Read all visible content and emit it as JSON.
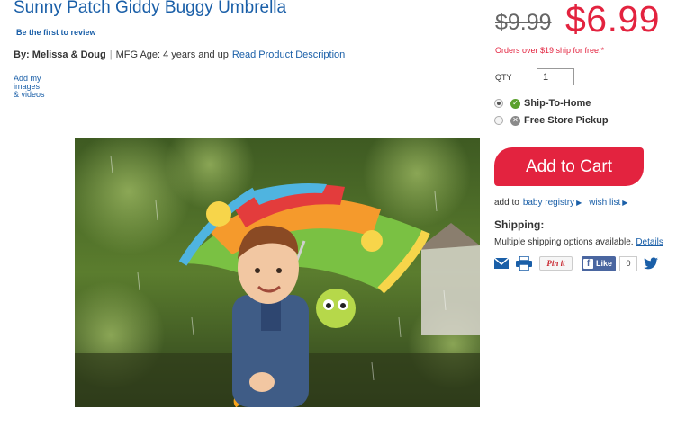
{
  "product": {
    "title": "Sunny Patch Giddy Buggy Umbrella",
    "review_link": "Be the first to review",
    "by_label": "By:",
    "brand": "Melissa & Doug",
    "mfg_age": "MFG Age: 4 years and up",
    "description_link": "Read Product Description",
    "add_media_lines": [
      "Add my",
      "images",
      "& videos"
    ]
  },
  "pricing": {
    "old_price": "$9.99",
    "new_price": "$6.99",
    "shipping_note": "Orders over $19 ship for free.*"
  },
  "purchase": {
    "qty_label": "QTY",
    "qty_value": "1",
    "options": [
      {
        "label": "Ship-To-Home",
        "selected": true,
        "status_icon": "check-circle-icon"
      },
      {
        "label": "Free Store Pickup",
        "selected": false,
        "status_icon": "x-circle-icon"
      }
    ],
    "add_to_cart_label": "Add to Cart"
  },
  "registry": {
    "prefix": "add to",
    "baby_registry": "baby registry",
    "wish_list": "wish list"
  },
  "shipping": {
    "heading": "Shipping:",
    "text": "Multiple shipping options available.",
    "details_link": "Details"
  },
  "share": {
    "pin_label": "Pin it",
    "like_label": "Like",
    "like_count": "0",
    "icons": [
      "email-icon",
      "print-icon",
      "pinterest-button",
      "facebook-like-button",
      "twitter-icon"
    ]
  },
  "colors": {
    "brand_red": "#e3233f",
    "link_blue": "#1a5fa8",
    "title_blue": "#1a5fa8"
  }
}
